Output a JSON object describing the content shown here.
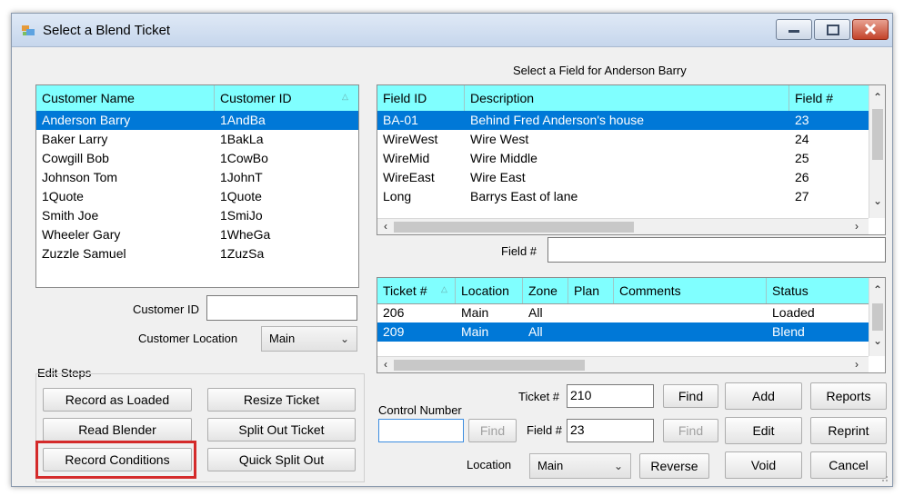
{
  "window": {
    "title": "Select a Blend Ticket"
  },
  "customers": {
    "columns": [
      "Customer Name",
      "Customer ID"
    ],
    "sort_glyph": "△",
    "rows": [
      [
        "Anderson Barry",
        "1AndBa"
      ],
      [
        "Baker Larry",
        "1BakLa"
      ],
      [
        "Cowgill Bob",
        "1CowBo"
      ],
      [
        "Johnson Tom",
        "1JohnT"
      ],
      [
        "1Quote",
        "1Quote"
      ],
      [
        "Smith Joe",
        "1SmiJo"
      ],
      [
        "Wheeler Gary",
        "1WheGa"
      ],
      [
        "Zuzzle Samuel",
        "1ZuzSa"
      ]
    ],
    "selected_index": 0
  },
  "customer_id": {
    "label": "Customer ID",
    "value": ""
  },
  "customer_location": {
    "label": "Customer Location",
    "value": "Main"
  },
  "fields": {
    "heading": "Select a Field for Anderson Barry",
    "columns": [
      "Field ID",
      "Description",
      "Field #"
    ],
    "rows": [
      [
        "BA-01",
        "Behind Fred Anderson's house",
        "23"
      ],
      [
        "WireWest",
        "Wire West",
        "24"
      ],
      [
        "WireMid",
        "Wire Middle",
        "25"
      ],
      [
        "WireEast",
        "Wire East",
        "26"
      ],
      [
        "Long",
        "Barrys East of lane",
        "27"
      ]
    ],
    "selected_index": 0
  },
  "field_filter": {
    "label": "Field #",
    "value": ""
  },
  "tickets": {
    "columns": [
      "Ticket #",
      "Location",
      "Zone",
      "Plan",
      "Comments",
      "Status"
    ],
    "sort_glyph": "△",
    "rows": [
      [
        "206",
        "Main",
        "All",
        "",
        "",
        "Loaded"
      ],
      [
        "209",
        "Main",
        "All",
        "",
        "",
        "Blend"
      ]
    ],
    "selected_index": 1
  },
  "edit_steps": {
    "label": "Edit Steps",
    "buttons": [
      "Record as Loaded",
      "Resize Ticket",
      "Read Blender",
      "Split Out Ticket",
      "Record Conditions",
      "Quick Split Out"
    ]
  },
  "control_number": {
    "label": "Control Number",
    "value": "",
    "find_label": "Find"
  },
  "ticket_search": {
    "label": "Ticket #",
    "value": "210",
    "find_label": "Find"
  },
  "field_search": {
    "label": "Field #",
    "value": "23",
    "find_label": "Find"
  },
  "location": {
    "label": "Location",
    "value": "Main"
  },
  "actions": {
    "add": "Add",
    "reports": "Reports",
    "edit": "Edit",
    "reprint": "Reprint",
    "reverse": "Reverse",
    "void": "Void",
    "cancel": "Cancel"
  },
  "colors": {
    "header": "#80ffff",
    "selection": "#0078d7",
    "highlight": "#d42a2a"
  }
}
